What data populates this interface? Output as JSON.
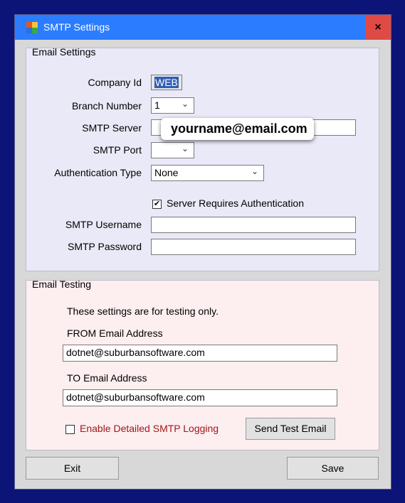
{
  "window": {
    "title": "SMTP Settings",
    "close_label": "×"
  },
  "email_settings": {
    "legend": "Email Settings",
    "company_id_label": "Company Id",
    "company_id_value": "WEB",
    "branch_number_label": "Branch Number",
    "branch_number_value": "1",
    "smtp_server_label": "SMTP Server",
    "smtp_server_value": "",
    "smtp_port_label": "SMTP Port",
    "smtp_port_value": "",
    "auth_type_label": "Authentication Type",
    "auth_type_value": "None",
    "requires_auth_label": "Server Requires Authentication",
    "requires_auth_checked": true,
    "smtp_username_label": "SMTP Username",
    "smtp_username_value": "",
    "smtp_password_label": "SMTP Password",
    "smtp_password_value": ""
  },
  "email_testing": {
    "legend": "Email Testing",
    "note": "These settings are for testing only.",
    "from_label": "FROM Email Address",
    "from_value": "dotnet@suburbansoftware.com",
    "to_label": "TO Email Address",
    "to_value": "dotnet@suburbansoftware.com",
    "logging_label": "Enable Detailed SMTP Logging",
    "logging_checked": false,
    "send_test_label": "Send Test Email"
  },
  "buttons": {
    "exit_label": "Exit",
    "save_label": "Save"
  },
  "overlay": {
    "text": "yourname@email.com"
  },
  "icons": {
    "dropdown": "chevron-down-icon",
    "check": "checkmark-icon"
  },
  "colors": {
    "title_bar": "#2b7cff",
    "close": "#e04a45",
    "logging_text": "#a01818"
  }
}
